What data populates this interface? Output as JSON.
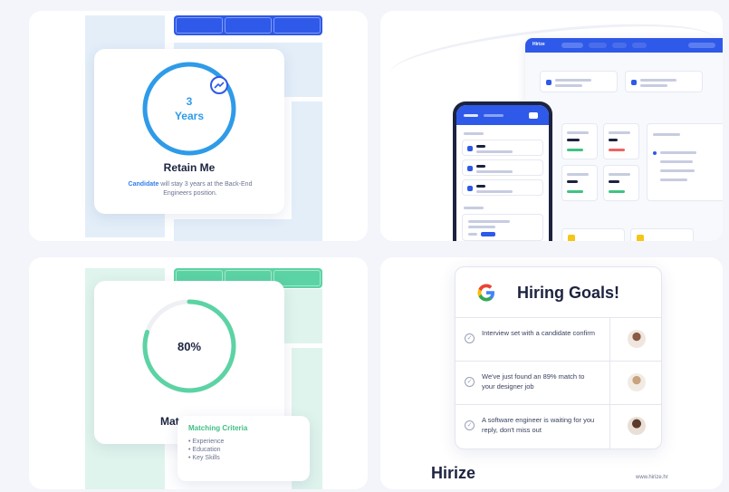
{
  "retain_card": {
    "ring_value": "3",
    "ring_unit": "Years",
    "title": "Retain Me",
    "description_highlight": "Candidate",
    "description_rest": " will stay 3 years at the Back-End Engineers position.",
    "ring_color": "#2f9be8"
  },
  "match_card": {
    "percent": "80%",
    "progress": 0.8,
    "title": "Match Rate",
    "criteria_title": "Matching Criteria",
    "criteria_items": [
      "Experience",
      "Education",
      "Key Skills"
    ],
    "ring_color": "#5cd3a4"
  },
  "dashboard_card": {
    "nav_logo": "Hirize"
  },
  "goals_card": {
    "title": "Hiring Goals!",
    "items": [
      {
        "text": "Interview set with a candidate confirm"
      },
      {
        "text": "We've just found an 89% match to your designer job"
      },
      {
        "text": "A software engineer is waiting for you reply, don't miss out"
      }
    ],
    "brand": "Hirize",
    "url": "www.hirize.hr"
  }
}
